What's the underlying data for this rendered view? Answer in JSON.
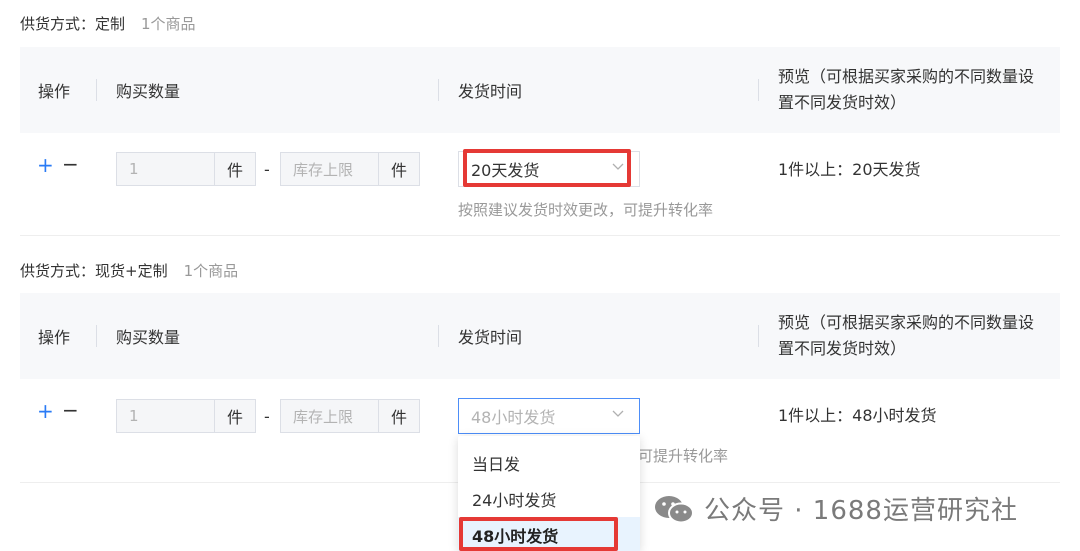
{
  "sections": [
    {
      "label": "供货方式：定制",
      "count": "1个商品",
      "headers": {
        "op": "操作",
        "qty": "购买数量",
        "ship": "发货时间",
        "preview": "预览（可根据买家采购的不同数量设置不同发货时效）"
      },
      "row": {
        "plus": "+",
        "minus": "−",
        "min_qty": "1",
        "unit": "件",
        "dash": "-",
        "max_placeholder": "库存上限",
        "unit2": "件",
        "ship_value": "20天发货",
        "hint": "按照建议发货时效更改，可提升转化率",
        "preview": "1件以上：20天发货"
      }
    },
    {
      "label": "供货方式：现货+定制",
      "count": "1个商品",
      "headers": {
        "op": "操作",
        "qty": "购买数量",
        "ship": "发货时间",
        "preview": "预览（可根据买家采购的不同数量设置不同发货时效）"
      },
      "row": {
        "plus": "+",
        "minus": "−",
        "min_qty": "1",
        "unit": "件",
        "dash": "-",
        "max_placeholder": "库存上限",
        "unit2": "件",
        "ship_placeholder": "48小时发货",
        "hint_visible": "可提升转化率",
        "preview": "1件以上：48小时发货"
      }
    }
  ],
  "dropdown": {
    "options": [
      "当日发",
      "24小时发货",
      "48小时发货"
    ],
    "selected_index": 2
  },
  "watermark": "公众号 · 1688运营研究社",
  "colors": {
    "accent": "#2a7bf5",
    "highlight": "#e53935",
    "header_bg": "#f7f8fa"
  }
}
